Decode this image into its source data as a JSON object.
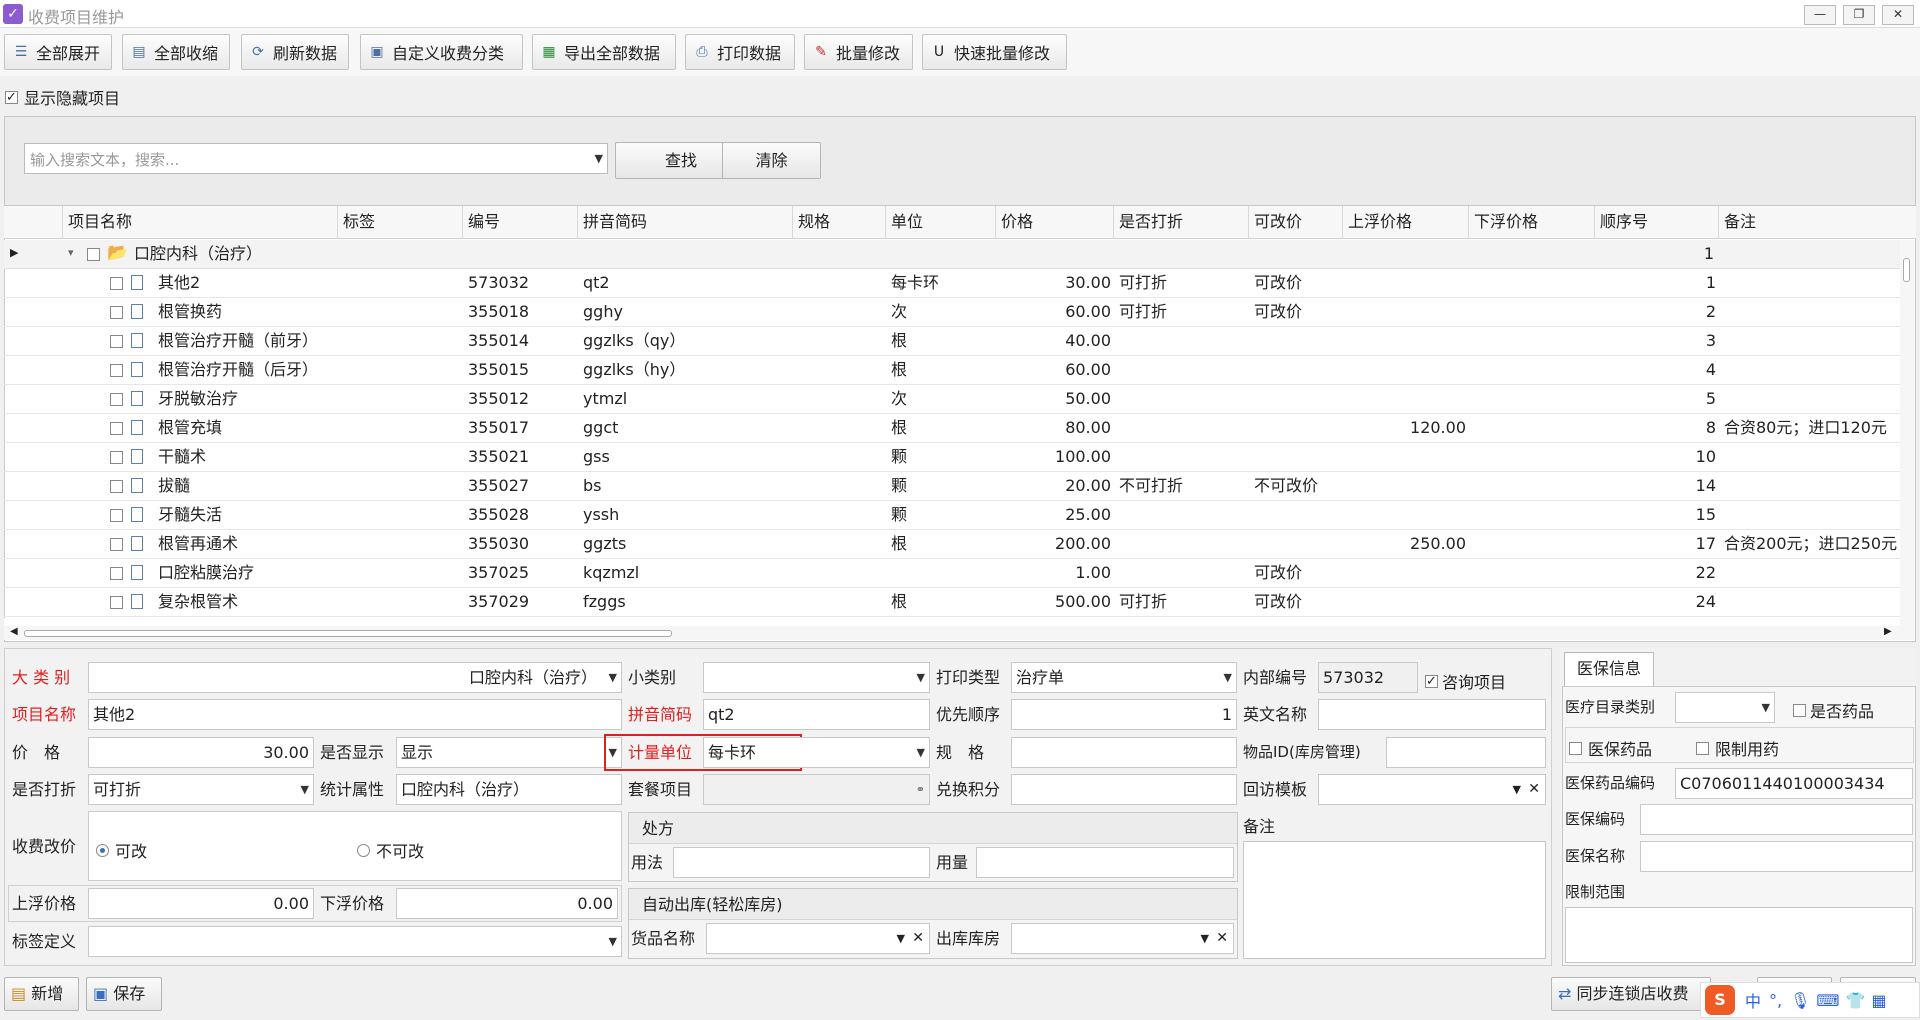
{
  "window": {
    "title": "收费项目维护"
  },
  "toolbar": {
    "expand_all": "全部展开",
    "collapse_all": "全部收缩",
    "refresh": "刷新数据",
    "custom_category": "自定义收费分类",
    "export_all": "导出全部数据",
    "print": "打印数据",
    "batch_edit": "批量修改",
    "quick_batch_edit": "快速批量修改"
  },
  "show_hidden": "显示隐藏项目",
  "search": {
    "placeholder": "输入搜索文本，搜索...",
    "find": "查找",
    "clear": "清除"
  },
  "grid": {
    "columns": [
      "项目名称",
      "标签",
      "编号",
      "拼音简码",
      "规格",
      "单位",
      "价格",
      "是否打折",
      "可改价",
      "上浮价格",
      "下浮价格",
      "顺序号",
      "备注"
    ],
    "group": {
      "name": "口腔内科（治疗）",
      "order": "1"
    },
    "rows": [
      {
        "name": "其他2",
        "code": "573032",
        "pinyin": "qt2",
        "unit": "每卡环",
        "price": "30.00",
        "discount": "可打折",
        "editable": "可改价",
        "up": "",
        "order": "1",
        "note": ""
      },
      {
        "name": "根管换药",
        "code": "355018",
        "pinyin": "gghy",
        "unit": "次",
        "price": "60.00",
        "discount": "可打折",
        "editable": "可改价",
        "up": "",
        "order": "2",
        "note": ""
      },
      {
        "name": "根管治疗开髓（前牙）",
        "code": "355014",
        "pinyin": "ggzlks（qy）",
        "unit": "根",
        "price": "40.00",
        "discount": "",
        "editable": "",
        "up": "",
        "order": "3",
        "note": ""
      },
      {
        "name": "根管治疗开髓（后牙）",
        "code": "355015",
        "pinyin": "ggzlks（hy）",
        "unit": "根",
        "price": "60.00",
        "discount": "",
        "editable": "",
        "up": "",
        "order": "4",
        "note": ""
      },
      {
        "name": "牙脱敏治疗",
        "code": "355012",
        "pinyin": "ytmzl",
        "unit": "次",
        "price": "50.00",
        "discount": "",
        "editable": "",
        "up": "",
        "order": "5",
        "note": ""
      },
      {
        "name": "根管充填",
        "code": "355017",
        "pinyin": "ggct",
        "unit": "根",
        "price": "80.00",
        "discount": "",
        "editable": "",
        "up": "120.00",
        "order": "8",
        "note": "合资80元；进口120元"
      },
      {
        "name": "干髓术",
        "code": "355021",
        "pinyin": "gss",
        "unit": "颗",
        "price": "100.00",
        "discount": "",
        "editable": "",
        "up": "",
        "order": "10",
        "note": ""
      },
      {
        "name": "拔髓",
        "code": "355027",
        "pinyin": "bs",
        "unit": "颗",
        "price": "20.00",
        "discount": "不可打折",
        "editable": "不可改价",
        "up": "",
        "order": "14",
        "note": ""
      },
      {
        "name": "牙髓失活",
        "code": "355028",
        "pinyin": "yssh",
        "unit": "颗",
        "price": "25.00",
        "discount": "",
        "editable": "",
        "up": "",
        "order": "15",
        "note": ""
      },
      {
        "name": "根管再通术",
        "code": "355030",
        "pinyin": "ggzts",
        "unit": "根",
        "price": "200.00",
        "discount": "",
        "editable": "",
        "up": "250.00",
        "order": "17",
        "note": "合资200元；进口250元"
      },
      {
        "name": "口腔粘膜治疗",
        "code": "357025",
        "pinyin": "kqzmzl",
        "unit": "",
        "price": "1.00",
        "discount": "",
        "editable": "可改价",
        "up": "",
        "order": "22",
        "note": ""
      },
      {
        "name": "复杂根管术",
        "code": "357029",
        "pinyin": "fzggs",
        "unit": "根",
        "price": "500.00",
        "discount": "可打折",
        "editable": "可改价",
        "up": "",
        "order": "24",
        "note": ""
      }
    ]
  },
  "form": {
    "big_category_label": "大 类 别",
    "big_category": "口腔内科（治疗）",
    "sub_category_label": "小类别",
    "sub_category": "",
    "print_type_label": "打印类型",
    "print_type": "治疗单",
    "internal_code_label": "内部编号",
    "internal_code": "573032",
    "consult_label": "咨询项目",
    "name_label": "项目名称",
    "name": "其他2",
    "pinyin_label": "拼音简码",
    "pinyin": "qt2",
    "priority_label": "优先顺序",
    "priority": "1",
    "english_label": "英文名称",
    "english": "",
    "price_label": "价　格",
    "price": "30.00",
    "show_label": "是否显示",
    "show": "显示",
    "unit_label": "计量单位",
    "unit": "每卡环",
    "spec_label": "规　格",
    "spec": "",
    "item_id_label": "物品ID(库房管理)",
    "item_id": "",
    "discount_label": "是否打折",
    "discount": "可打折",
    "stat_label": "统计属性",
    "stat": "口腔内科（治疗）",
    "package_label": "套餐项目",
    "package": "",
    "points_label": "兑换积分",
    "points": "",
    "visit_label": "回访模板",
    "visit": "",
    "price_edit_label": "收费改价",
    "can_edit": "可改",
    "cannot_edit": "不可改",
    "prescription_title": "处方",
    "usage_label": "用法",
    "usage": "",
    "dosage_label": "用量",
    "dosage": "",
    "remark_label": "备注",
    "remark": "",
    "up_label": "上浮价格",
    "up": "0.00",
    "down_label": "下浮价格",
    "down": "0.00",
    "auto_out_title": "自动出库(轻松库房)",
    "goods_label": "货品名称",
    "goods": "",
    "warehouse_label": "出库库房",
    "warehouse": "",
    "tag_label": "标签定义",
    "tag": ""
  },
  "insurance": {
    "tab": "医保信息",
    "catalog_label": "医疗目录类别",
    "catalog": "",
    "is_drug": "是否药品",
    "ins_drug": "医保药品",
    "restricted": "限制用药",
    "drug_code_label": "医保药品编码",
    "drug_code": "C0706011440100003434",
    "ins_code_label": "医保编码",
    "ins_code": "",
    "ins_name_label": "医保名称",
    "ins_name": "",
    "scope_label": "限制范围",
    "scope": ""
  },
  "bottom": {
    "add": "新增",
    "save": "保存",
    "sync": "同步连锁店收费"
  },
  "ime": {
    "lang": "中"
  }
}
